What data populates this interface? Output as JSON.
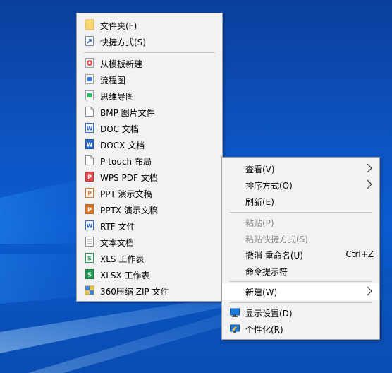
{
  "desktop_context_menu": {
    "items": [
      {
        "label": "查看(V)",
        "has_submenu": true
      },
      {
        "label": "排序方式(O)",
        "has_submenu": true
      },
      {
        "label": "刷新(E)"
      },
      {
        "label": "粘贴(P)",
        "disabled": true
      },
      {
        "label": "粘贴快捷方式(S)",
        "disabled": true
      },
      {
        "label": "撤消 重命名(U)",
        "shortcut": "Ctrl+Z"
      },
      {
        "label": "命令提示符"
      },
      {
        "label": "新建(W)",
        "has_submenu": true,
        "highlighted": true
      },
      {
        "label": "显示设置(D)",
        "icon": "display-settings-icon"
      },
      {
        "label": "个性化(R)",
        "icon": "personalize-icon"
      }
    ]
  },
  "new_submenu": {
    "items": [
      {
        "label": "文件夹(F)",
        "icon": "folder-icon"
      },
      {
        "label": "快捷方式(S)",
        "icon": "shortcut-icon"
      },
      {
        "label": "从模板新建",
        "icon": "template-icon"
      },
      {
        "label": "流程图",
        "icon": "flowchart-icon"
      },
      {
        "label": "思维导图",
        "icon": "mindmap-icon"
      },
      {
        "label": "BMP 图片文件",
        "icon": "blank-file-icon"
      },
      {
        "label": "DOC 文档",
        "icon": "word-doc-icon"
      },
      {
        "label": "DOCX 文档",
        "icon": "word-doc-icon"
      },
      {
        "label": "P-touch 布局",
        "icon": "blank-file-icon"
      },
      {
        "label": "WPS PDF 文档",
        "icon": "pdf-icon"
      },
      {
        "label": "PPT 演示文稿",
        "icon": "ppt-icon"
      },
      {
        "label": "PPTX 演示文稿",
        "icon": "ppt-icon"
      },
      {
        "label": "RTF 文件",
        "icon": "word-doc-icon"
      },
      {
        "label": "文本文档",
        "icon": "text-file-icon"
      },
      {
        "label": "XLS 工作表",
        "icon": "spreadsheet-icon"
      },
      {
        "label": "XLSX 工作表",
        "icon": "spreadsheet-icon"
      },
      {
        "label": "360压缩 ZIP 文件",
        "icon": "zip-archive-icon"
      }
    ]
  },
  "colors": {
    "menu_bg": "#f2f2f2",
    "highlight": "#ffffff",
    "disabled_text": "#8a8a8a",
    "desktop_blue": "#0d55c4"
  }
}
